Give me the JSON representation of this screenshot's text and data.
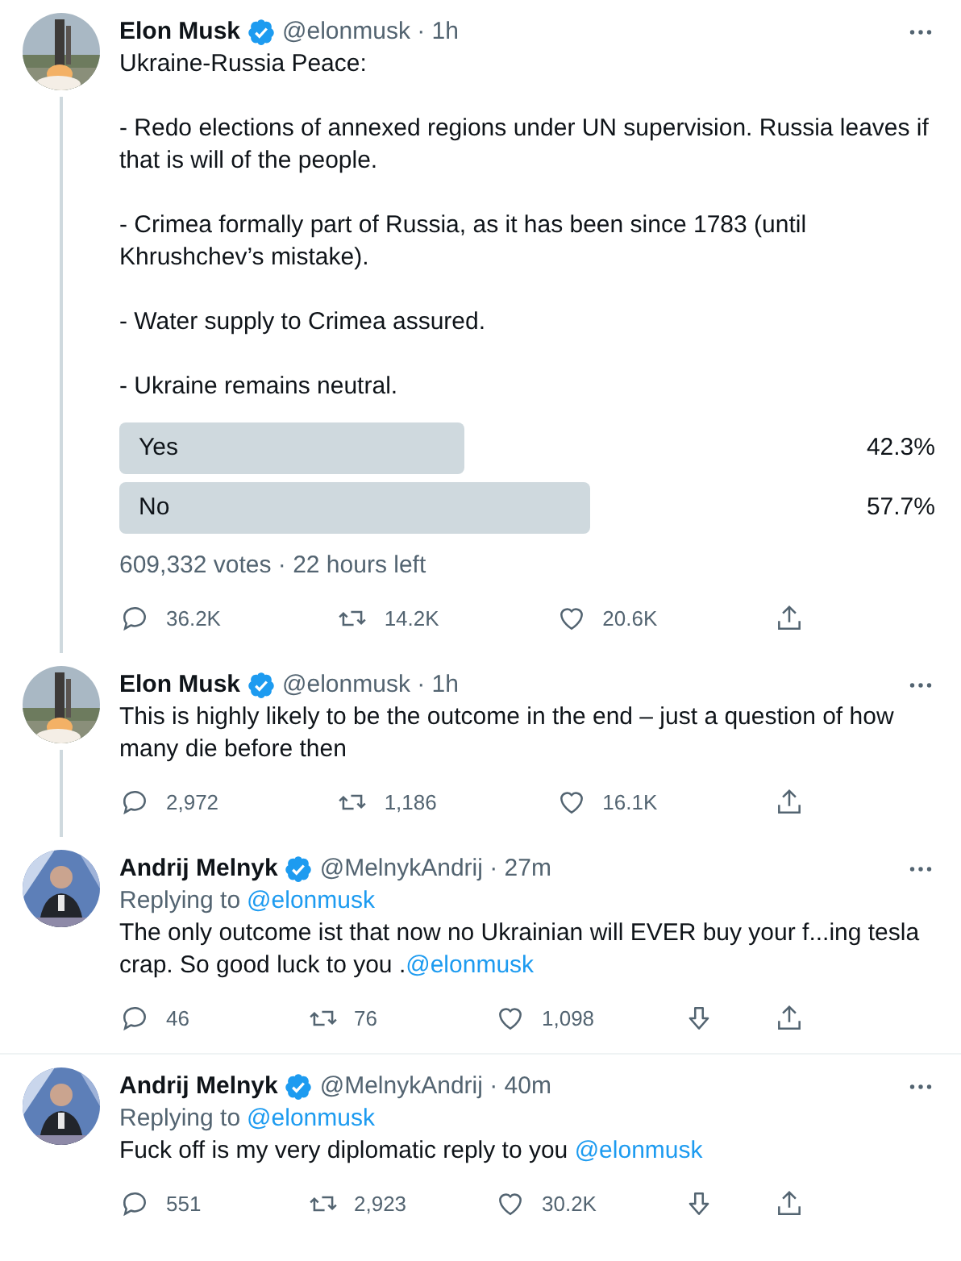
{
  "tweets": [
    {
      "author": "Elon Musk",
      "verified": true,
      "meta": "@elonmusk · 1h",
      "thread_line": true,
      "divider": false,
      "paragraphs": [
        [
          {
            "kind": "text",
            "text": "Ukraine-Russia Peace:"
          }
        ],
        [
          {
            "kind": "text",
            "text": "- Redo elections of annexed regions under UN supervision. Russia leaves if that is will of the people."
          }
        ],
        [
          {
            "kind": "text",
            "text": "- Crimea formally part of Russia, as it has been since 1783 (until Khrushchev’s mistake)."
          }
        ],
        [
          {
            "kind": "text",
            "text": "- Water supply to Crimea assured."
          }
        ],
        [
          {
            "kind": "text",
            "text": "- Ukraine remains neutral."
          }
        ]
      ],
      "poll": {
        "options": [
          {
            "label": "Yes",
            "percent": "42.3%"
          },
          {
            "label": "No",
            "percent": "57.7%"
          }
        ],
        "summary": "609,332 votes · 22 hours left"
      },
      "actions": [
        {
          "kind": "reply",
          "count": "36.2K"
        },
        {
          "kind": "retweet",
          "count": "14.2K"
        },
        {
          "kind": "like",
          "count": "20.6K"
        },
        {
          "kind": "share"
        }
      ]
    },
    {
      "author": "Elon Musk",
      "verified": true,
      "meta": "@elonmusk · 1h",
      "thread_line": true,
      "divider": false,
      "paragraphs": [
        [
          {
            "kind": "text",
            "text": "This is highly likely to be the outcome in the end – just a question of how many die before then"
          }
        ]
      ],
      "actions": [
        {
          "kind": "reply",
          "count": "2,972"
        },
        {
          "kind": "retweet",
          "count": "1,186"
        },
        {
          "kind": "like",
          "count": "16.1K"
        },
        {
          "kind": "share"
        }
      ]
    },
    {
      "author": "Andrij Melnyk",
      "verified": true,
      "meta": "@MelnykAndrij · 27m",
      "thread_line": false,
      "divider": true,
      "replying_to": {
        "label": "Replying to",
        "mention": "@elonmusk"
      },
      "paragraphs": [
        [
          {
            "kind": "text",
            "text": "The only outcome ist that now no Ukrainian will EVER buy your f...ing tesla crap. So good luck to you ."
          },
          {
            "kind": "mention",
            "text": "@elonmusk"
          }
        ]
      ],
      "actions": [
        {
          "kind": "reply",
          "count": "46"
        },
        {
          "kind": "retweet",
          "count": "76"
        },
        {
          "kind": "like",
          "count": "1,098"
        },
        {
          "kind": "downvote"
        },
        {
          "kind": "share"
        }
      ]
    },
    {
      "author": "Andrij Melnyk",
      "verified": true,
      "meta": "@MelnykAndrij · 40m",
      "thread_line": false,
      "divider": false,
      "replying_to": {
        "label": "Replying to",
        "mention": "@elonmusk"
      },
      "paragraphs": [
        [
          {
            "kind": "text",
            "text": "Fuck off is my very diplomatic reply to you "
          },
          {
            "kind": "mention",
            "text": "@elonmusk"
          }
        ]
      ],
      "actions": [
        {
          "kind": "reply",
          "count": "551"
        },
        {
          "kind": "retweet",
          "count": "2,923"
        },
        {
          "kind": "like",
          "count": "30.2K"
        },
        {
          "kind": "downvote"
        },
        {
          "kind": "share"
        }
      ]
    }
  ]
}
